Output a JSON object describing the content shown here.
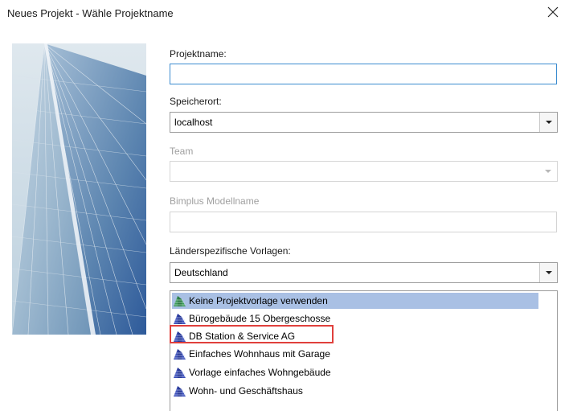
{
  "window": {
    "title": "Neues Projekt - Wähle Projektname",
    "close_icon": "close-icon"
  },
  "form": {
    "projektname": {
      "label": "Projektname:",
      "value": ""
    },
    "speicherort": {
      "label": "Speicherort:",
      "value": "localhost"
    },
    "team": {
      "label": "Team",
      "value": ""
    },
    "bimplus": {
      "label": "Bimplus Modellname",
      "value": ""
    },
    "vorlagen_land": {
      "label": "Länderspezifische Vorlagen:",
      "value": "Deutschland"
    }
  },
  "templates": {
    "items": [
      {
        "label": "Keine Projektvorlage verwenden",
        "icon": "building-green-icon",
        "selected": true
      },
      {
        "label": "Bürogebäude 15 Obergeschosse",
        "icon": "building-blue-icon",
        "selected": false
      },
      {
        "label": "DB Station & Service AG",
        "icon": "building-blue-icon",
        "selected": false,
        "highlighted": true
      },
      {
        "label": "Einfaches Wohnhaus mit Garage",
        "icon": "building-blue-icon",
        "selected": false
      },
      {
        "label": "Vorlage einfaches Wohngebäude",
        "icon": "building-blue-icon",
        "selected": false
      },
      {
        "label": "Wohn- und Geschäftshaus",
        "icon": "building-blue-icon",
        "selected": false
      }
    ]
  },
  "colors": {
    "selection": "#a9c0e4",
    "highlight_border": "#e0403c",
    "focus_border": "#3c8cd0",
    "icon_blue": "#3c4fb8",
    "icon_green": "#3d9a5a"
  }
}
